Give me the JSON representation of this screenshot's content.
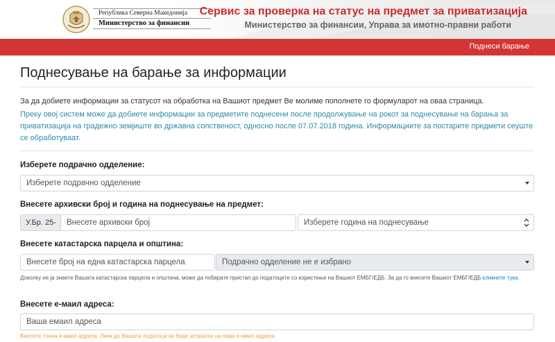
{
  "header": {
    "org_line1": "Република Северна Македонија",
    "org_line2": "Министерство за финансии",
    "service_title": "Сервис за проверка на статус на предмет за приватизација",
    "service_subtitle": "Министерство за финансии, Управа за имотно-правни работи"
  },
  "nav": {
    "submit_request": "Поднеси барање"
  },
  "main": {
    "title": "Поднесување на барање за информации",
    "intro_line1": "За да добиете информации за статусот на обработка на Вашиот предмет Ве молиме пополнете го формуларот на оваа страница.",
    "intro_line2": "Преку овој систем може да добиете информации за предметите поднесени после продолжување на рокот за поднесување на барања за приватизација на градежно земјиште во државна сопственост, односно после 07.07.2018 година. Информациите за постарите предмети сеуште се обработуваат."
  },
  "form": {
    "department": {
      "label": "Изберете подрачно одделение:",
      "selected": "Изберете подрачно одделение"
    },
    "archive": {
      "label": "Внесете архивски број и година на поднесување на предмет:",
      "prefix": "У.Бр. 25-",
      "number_placeholder": "Внесете архивски број",
      "year_selected": "Изберете година на поднесување"
    },
    "cadastral": {
      "label": "Внесете катастарска парцела и општина:",
      "parcel_placeholder": "Внесете број на една катастарска парцела",
      "municipality_selected": "Подрачно одделение не е избрано"
    },
    "help": {
      "text": "Доколку не ја знаете Вашата катастарска парцела и општина, може да побарате пристап до податоците со користење на Вашиот ЕМБГ/ЕДБ. За да го внесете Вашиот ЕМБГ/ЕДБ ",
      "link": "кликнете тука",
      "end": "."
    },
    "email": {
      "label": "Внесете е-маил адреса:",
      "placeholder": "Ваша емаил адреса",
      "note": "Внесете точна е-маил адреса. Линк до Вашите податоци ќе биде испратен на оваа е-маил адреса."
    }
  },
  "colors": {
    "brand_red": "#d33535",
    "title_red": "#cc2b2b",
    "info_teal": "#2a8aa8",
    "link_blue": "#1a7acc",
    "warning_orange": "#f0a030"
  },
  "icons": {
    "logo": "coat-of-arms-icon",
    "select_caret": "caret-down-icon",
    "select_chevron": "chevron-updown-icon"
  }
}
